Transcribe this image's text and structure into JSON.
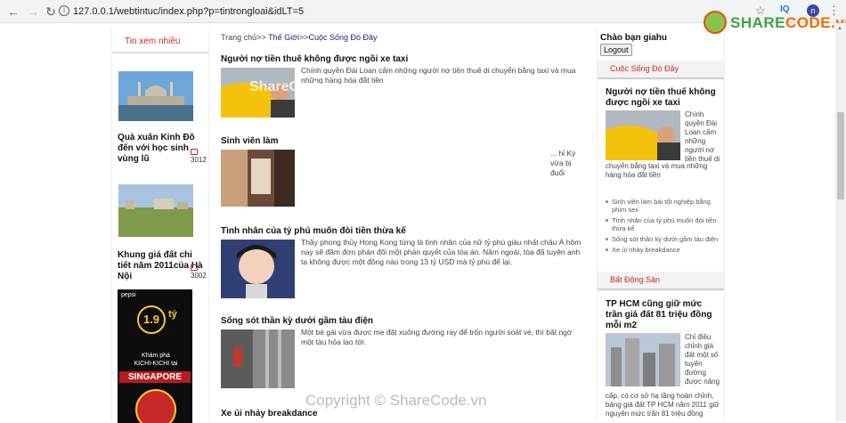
{
  "browser": {
    "url": "127.0.0.1/webtintuc/index.php?p=tintrongloai&idLT=5",
    "extension_label": "IQ",
    "profile_initial": "n"
  },
  "logo": {
    "part1": "SHARE",
    "part2": "CODE.vn"
  },
  "left": {
    "section_title": "Tin xem nhiều",
    "items": [
      {
        "title": "Quà xuân Kinh Đô đến với học sinh vùng lũ",
        "comments": "3012"
      },
      {
        "title": "Khung giá đất chi tiết năm 2011của Hà Nội",
        "comments": "3002"
      }
    ],
    "ad": {
      "brand": "pepsi",
      "amount": "1.9",
      "unit": "tỷ",
      "line1": "Khám phá",
      "line2": "KICHI-KICHI tại",
      "city": "SINGAPORE"
    }
  },
  "main": {
    "breadcrumb": {
      "home": "Trang chủ",
      "sep": ">>",
      "cat1": "Thế Giới",
      "cat2": "Cuộc Sống Đó Đây"
    },
    "articles": [
      {
        "title": "Người nợ tiền thuê không được ngồi xe taxi",
        "desc": "Chính quyền Đài Loan cấm những người nợ tiền thuế di chuyển bằng taxi và mua những hàng hóa đắt tiền"
      },
      {
        "title": "Sinh viên làm",
        "desc": "... hỉ Kỳ vừa bị đuổi"
      },
      {
        "title": "Tình nhân của tỷ phú muốn đòi tiền thừa kế",
        "desc": "Thầy phong thủy Hong Kong từng là tình nhân của nữ tỷ phú giàu nhất châu Á hôm nay sẽ đăm đơn phản đối một phán quyết của tòa án. Năm ngoái, tòa đã tuyên anh ta không được một đồng nào trong 13 tỷ USD mà tỷ phú để lại."
      },
      {
        "title": "Sống sót thần kỳ dưới gầm tàu điện",
        "desc": "Một bé gái vừa được mẹ đặt xuống đường ray để trốn người soát vé, thì bất ngờ một tàu hỏa lao tới."
      },
      {
        "title": "Xe ủi nhảy breakdance",
        "desc": ""
      }
    ],
    "watermark": "ShareCode.vn",
    "copyright": "Copyright © ShareCode.vn"
  },
  "right": {
    "greeting": "Chào bạn giahu",
    "logout_label": "Logout",
    "section1": {
      "title": "Cuộc Sống Đó Đây",
      "feature_title": "Người nợ tiền thuế không được ngồi xe taxi",
      "feature_side": "Chính quyền Đài Loan cấm những người nợ tiền thuế di",
      "feature_rest": "chuyển bằng taxi và mua những hàng hóa đắt tiền",
      "links": [
        "Sinh viên làm bài tốt nghiệp bằng phim sex",
        "Tình nhân của tỷ phú muốn đòi tiền thừa kế",
        "Sống sót thần kỳ dưới gầm tàu điện",
        "Xe ủi nhảy breakdance"
      ]
    },
    "section2": {
      "title": "Bất Động Sản",
      "feature_title": "TP HCM cũng giữ mức trần giá đất 81 triệu đồng mỗi m2",
      "feature_side": "Chỉ điều chỉnh giá đất một số tuyến đường được nâng",
      "feature_rest": "cấp, có cơ sở hạ tầng hoàn chỉnh, bảng giá đất TP HCM năm 2011 giữ nguyên mức trần 81 triệu đồng"
    }
  }
}
